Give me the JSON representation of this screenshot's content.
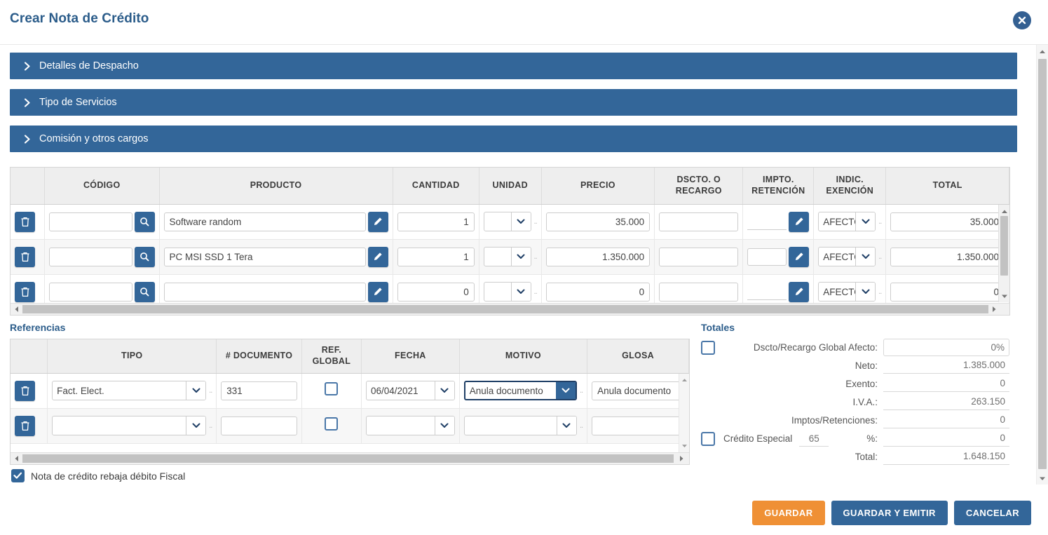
{
  "header": {
    "title": "Crear Nota de Crédito",
    "close_icon": "close-circle-icon"
  },
  "accordions": [
    {
      "label": "Detalles de Despacho",
      "icon": "chevron-right-icon"
    },
    {
      "label": "Tipo de Servicios",
      "icon": "chevron-right-icon"
    },
    {
      "label": "Comisión y otros cargos",
      "icon": "chevron-right-icon"
    }
  ],
  "product_grid": {
    "columns": [
      "",
      "CÓDIGO",
      "PRODUCTO",
      "CANTIDAD",
      "UNIDAD",
      "PRECIO",
      "DSCTO. O RECARGO",
      "IMPTO. RETENCIÓN",
      "INDIC. EXENCIÓN",
      "TOTAL"
    ],
    "col_dscto_line1": "DSCTO. O",
    "col_dscto_line2": "RECARGO",
    "col_impto_line1": "IMPTO.",
    "col_impto_line2": "RETENCIÓN",
    "col_indic_line1": "INDIC.",
    "col_indic_line2": "EXENCIÓN",
    "delete_icon": "trash-icon",
    "search_icon": "search-icon",
    "edit_icon": "pencil-icon",
    "rows": [
      {
        "codigo": "",
        "producto": "Software random",
        "cantidad": "1",
        "unidad": "",
        "precio": "35.000",
        "dscto": "",
        "impto": "",
        "indic_exencion": "AFECTO",
        "total": "35.000"
      },
      {
        "codigo": "",
        "producto": "PC MSI SSD 1 Tera",
        "cantidad": "1",
        "unidad": "",
        "precio": "1.350.000",
        "dscto": "",
        "impto": "",
        "indic_exencion": "AFECTO",
        "total": "1.350.000"
      },
      {
        "codigo": "",
        "producto": "",
        "cantidad": "0",
        "unidad": "",
        "precio": "0",
        "dscto": "",
        "impto": "",
        "indic_exencion": "AFECTO",
        "total": "0"
      }
    ]
  },
  "references": {
    "section_title": "Referencias",
    "columns": [
      "",
      "TIPO",
      "# DOCUMENTO",
      "REF. GLOBAL",
      "FECHA",
      "MOTIVO",
      "GLOSA"
    ],
    "col_ref_line1": "REF.",
    "col_ref_line2": "GLOBAL",
    "delete_icon": "trash-icon",
    "rows": [
      {
        "tipo": "Fact. Elect.",
        "documento": "331",
        "ref_global": false,
        "fecha": "06/04/2021",
        "motivo": "Anula documento",
        "motivo_focused": true,
        "glosa": "Anula documento"
      },
      {
        "tipo": "",
        "documento": "",
        "ref_global": false,
        "fecha": "",
        "motivo": "",
        "motivo_focused": false,
        "glosa": ""
      }
    ]
  },
  "totals": {
    "section_title": "Totales",
    "dscto_global_label": "Dscto/Recargo Global Afecto:",
    "dscto_global_value": "0%",
    "dscto_global_checked": false,
    "neto_label": "Neto:",
    "neto_value": "1.385.000",
    "exento_label": "Exento:",
    "exento_value": "0",
    "iva_label": "I.V.A.:",
    "iva_value": "263.150",
    "imptos_label": "Imptos/Retenciones:",
    "imptos_value": "0",
    "credito_label": "Crédito Especial",
    "credito_pct": "65",
    "credito_pct_symbol": "%:",
    "credito_value": "0",
    "credito_checked": false,
    "total_label": "Total:",
    "total_value": "1.648.150"
  },
  "bottom": {
    "checkbox_label": "Nota de crédito rebaja débito Fiscal",
    "checkbox_checked": true
  },
  "actions": {
    "save": "GUARDAR",
    "save_and_emit": "GUARDAR Y EMITIR",
    "cancel": "CANCELAR"
  },
  "colors": {
    "primary_blue": "#336699",
    "title_blue": "#2b5c8a",
    "orange": "#ef9035",
    "header_grey": "#eeeeee"
  }
}
